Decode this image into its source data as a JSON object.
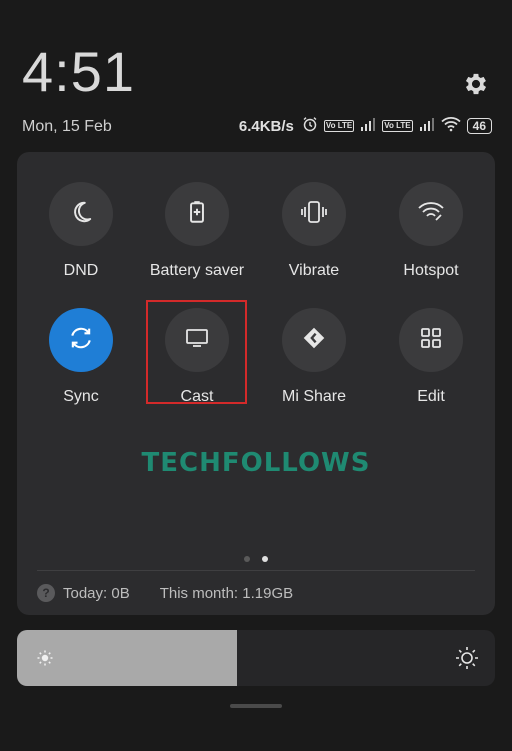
{
  "header": {
    "time": "4:51",
    "date": "Mon, 15 Feb",
    "network_speed": "6.4KB/s",
    "volte_badge": "Vo LTE",
    "battery_level": "46"
  },
  "tiles": [
    {
      "label": "DND",
      "icon": "moon-icon",
      "active": false
    },
    {
      "label": "Battery saver",
      "icon": "battery-saver-icon",
      "active": false
    },
    {
      "label": "Vibrate",
      "icon": "vibrate-icon",
      "active": false
    },
    {
      "label": "Hotspot",
      "icon": "hotspot-icon",
      "active": false
    },
    {
      "label": "Sync",
      "icon": "sync-icon",
      "active": true
    },
    {
      "label": "Cast",
      "icon": "cast-icon",
      "active": false
    },
    {
      "label": "Mi Share",
      "icon": "mi-share-icon",
      "active": false
    },
    {
      "label": "Edit",
      "icon": "grid-icon",
      "active": false
    }
  ],
  "watermark": "TECHFOLLOWS",
  "page_indicator": {
    "pages": 2,
    "current": 2
  },
  "data_usage": {
    "today": "Today: 0B",
    "month": "This month: 1.19GB",
    "help_glyph": "?"
  },
  "brightness": {
    "level_percent": 46
  },
  "colors": {
    "active_tile": "#1f7ed6",
    "highlight_box": "#d42a2a",
    "watermark": "#1f8a72"
  }
}
